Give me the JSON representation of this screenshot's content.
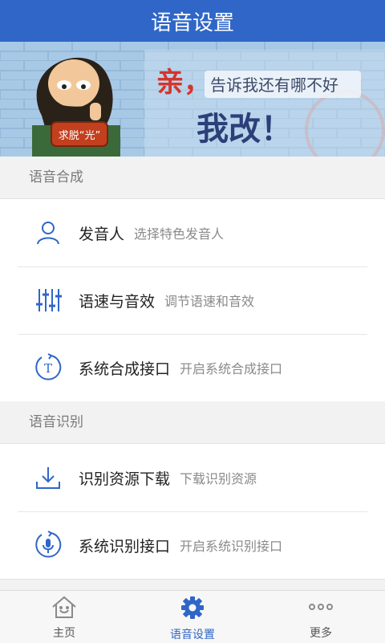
{
  "header": {
    "title": "语音设置"
  },
  "banner": {
    "line1": "亲，",
    "line2": "告诉我还有哪不好",
    "line3": "我改！",
    "badge": "求脱“光”"
  },
  "sections": [
    {
      "title": "语音合成",
      "items": [
        {
          "label": "发音人",
          "desc": "选择特色发音人",
          "icon": "person-icon"
        },
        {
          "label": "语速与音效",
          "desc": "调节语速和音效",
          "icon": "equalizer-icon"
        },
        {
          "label": "系统合成接口",
          "desc": "开启系统合成接口",
          "icon": "text-refresh-icon"
        }
      ]
    },
    {
      "title": "语音识别",
      "items": [
        {
          "label": "识别资源下载",
          "desc": "下载识别资源",
          "icon": "download-icon"
        },
        {
          "label": "系统识别接口",
          "desc": "开启系统识别接口",
          "icon": "mic-refresh-icon"
        }
      ]
    }
  ],
  "tabs": [
    {
      "label": "主页",
      "icon": "home-icon"
    },
    {
      "label": "语音设置",
      "icon": "gear-icon",
      "active": true
    },
    {
      "label": "更多",
      "icon": "more-icon"
    }
  ],
  "colors": {
    "accent": "#2f66c8",
    "background": "#f2f2f2"
  }
}
